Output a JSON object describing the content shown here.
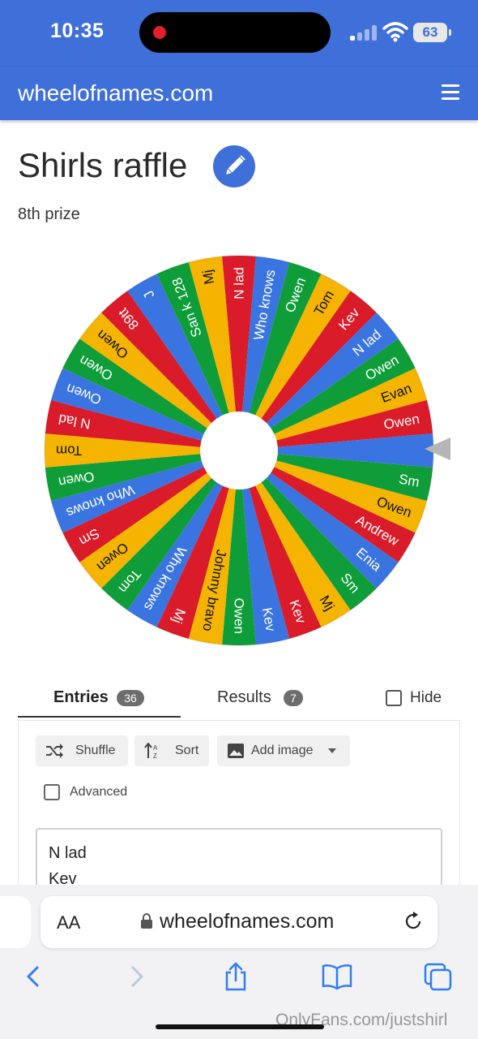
{
  "status_bar": {
    "time": "10:35",
    "battery": "63",
    "recording_color": "#e0202a"
  },
  "header": {
    "site_name": "wheelofnames.com",
    "menu_icon": "hamburger-menu-icon",
    "color": "#3f6fd8"
  },
  "wheel_info": {
    "title": "Shirls raffle",
    "subtitle": "8th prize",
    "edit_icon": "pencil-icon"
  },
  "wheel": {
    "colors": [
      "#d91b2a",
      "#3a74e0",
      "#0f9d3a",
      "#f5b400"
    ],
    "segments": [
      "N lad",
      "Who knows",
      "Owen",
      "Tom",
      "Kev",
      "N lad",
      "Owen",
      "Evan",
      "Owen",
      "",
      "Sm",
      "Owen",
      "Andrew",
      "Enia",
      "Sm",
      "Mj",
      "Kev",
      "Kev",
      "Owen",
      "Johnny bravo",
      "Mj",
      "Who knows",
      "Tom",
      "Owen",
      "Sm",
      "Who knows",
      "Owen",
      "Tom",
      "N lad",
      "Owen",
      "Owen",
      "Owen",
      "89tt",
      "J",
      "San k 128",
      "Mj"
    ],
    "pointer_icon": "pointer-triangle-icon"
  },
  "tabs": {
    "entries_label": "Entries",
    "entries_count": "36",
    "results_label": "Results",
    "results_count": "7",
    "hide_label": "Hide"
  },
  "toolbar": {
    "shuffle_label": "Shuffle",
    "shuffle_icon": "shuffle-icon",
    "sort_label": "Sort",
    "sort_icon": "sort-icon",
    "add_image_label": "Add image",
    "add_image_icon": "image-icon",
    "advanced_label": "Advanced"
  },
  "entries_text": [
    "N lad",
    "Kev"
  ],
  "browser": {
    "aa_label": "AA",
    "url": "wheelofnames.com",
    "nav_icons": [
      "back-chevron-icon",
      "forward-chevron-icon",
      "share-icon",
      "bookmarks-icon",
      "tabs-icon"
    ]
  },
  "watermark": "OnlyFans.com/justshirl"
}
